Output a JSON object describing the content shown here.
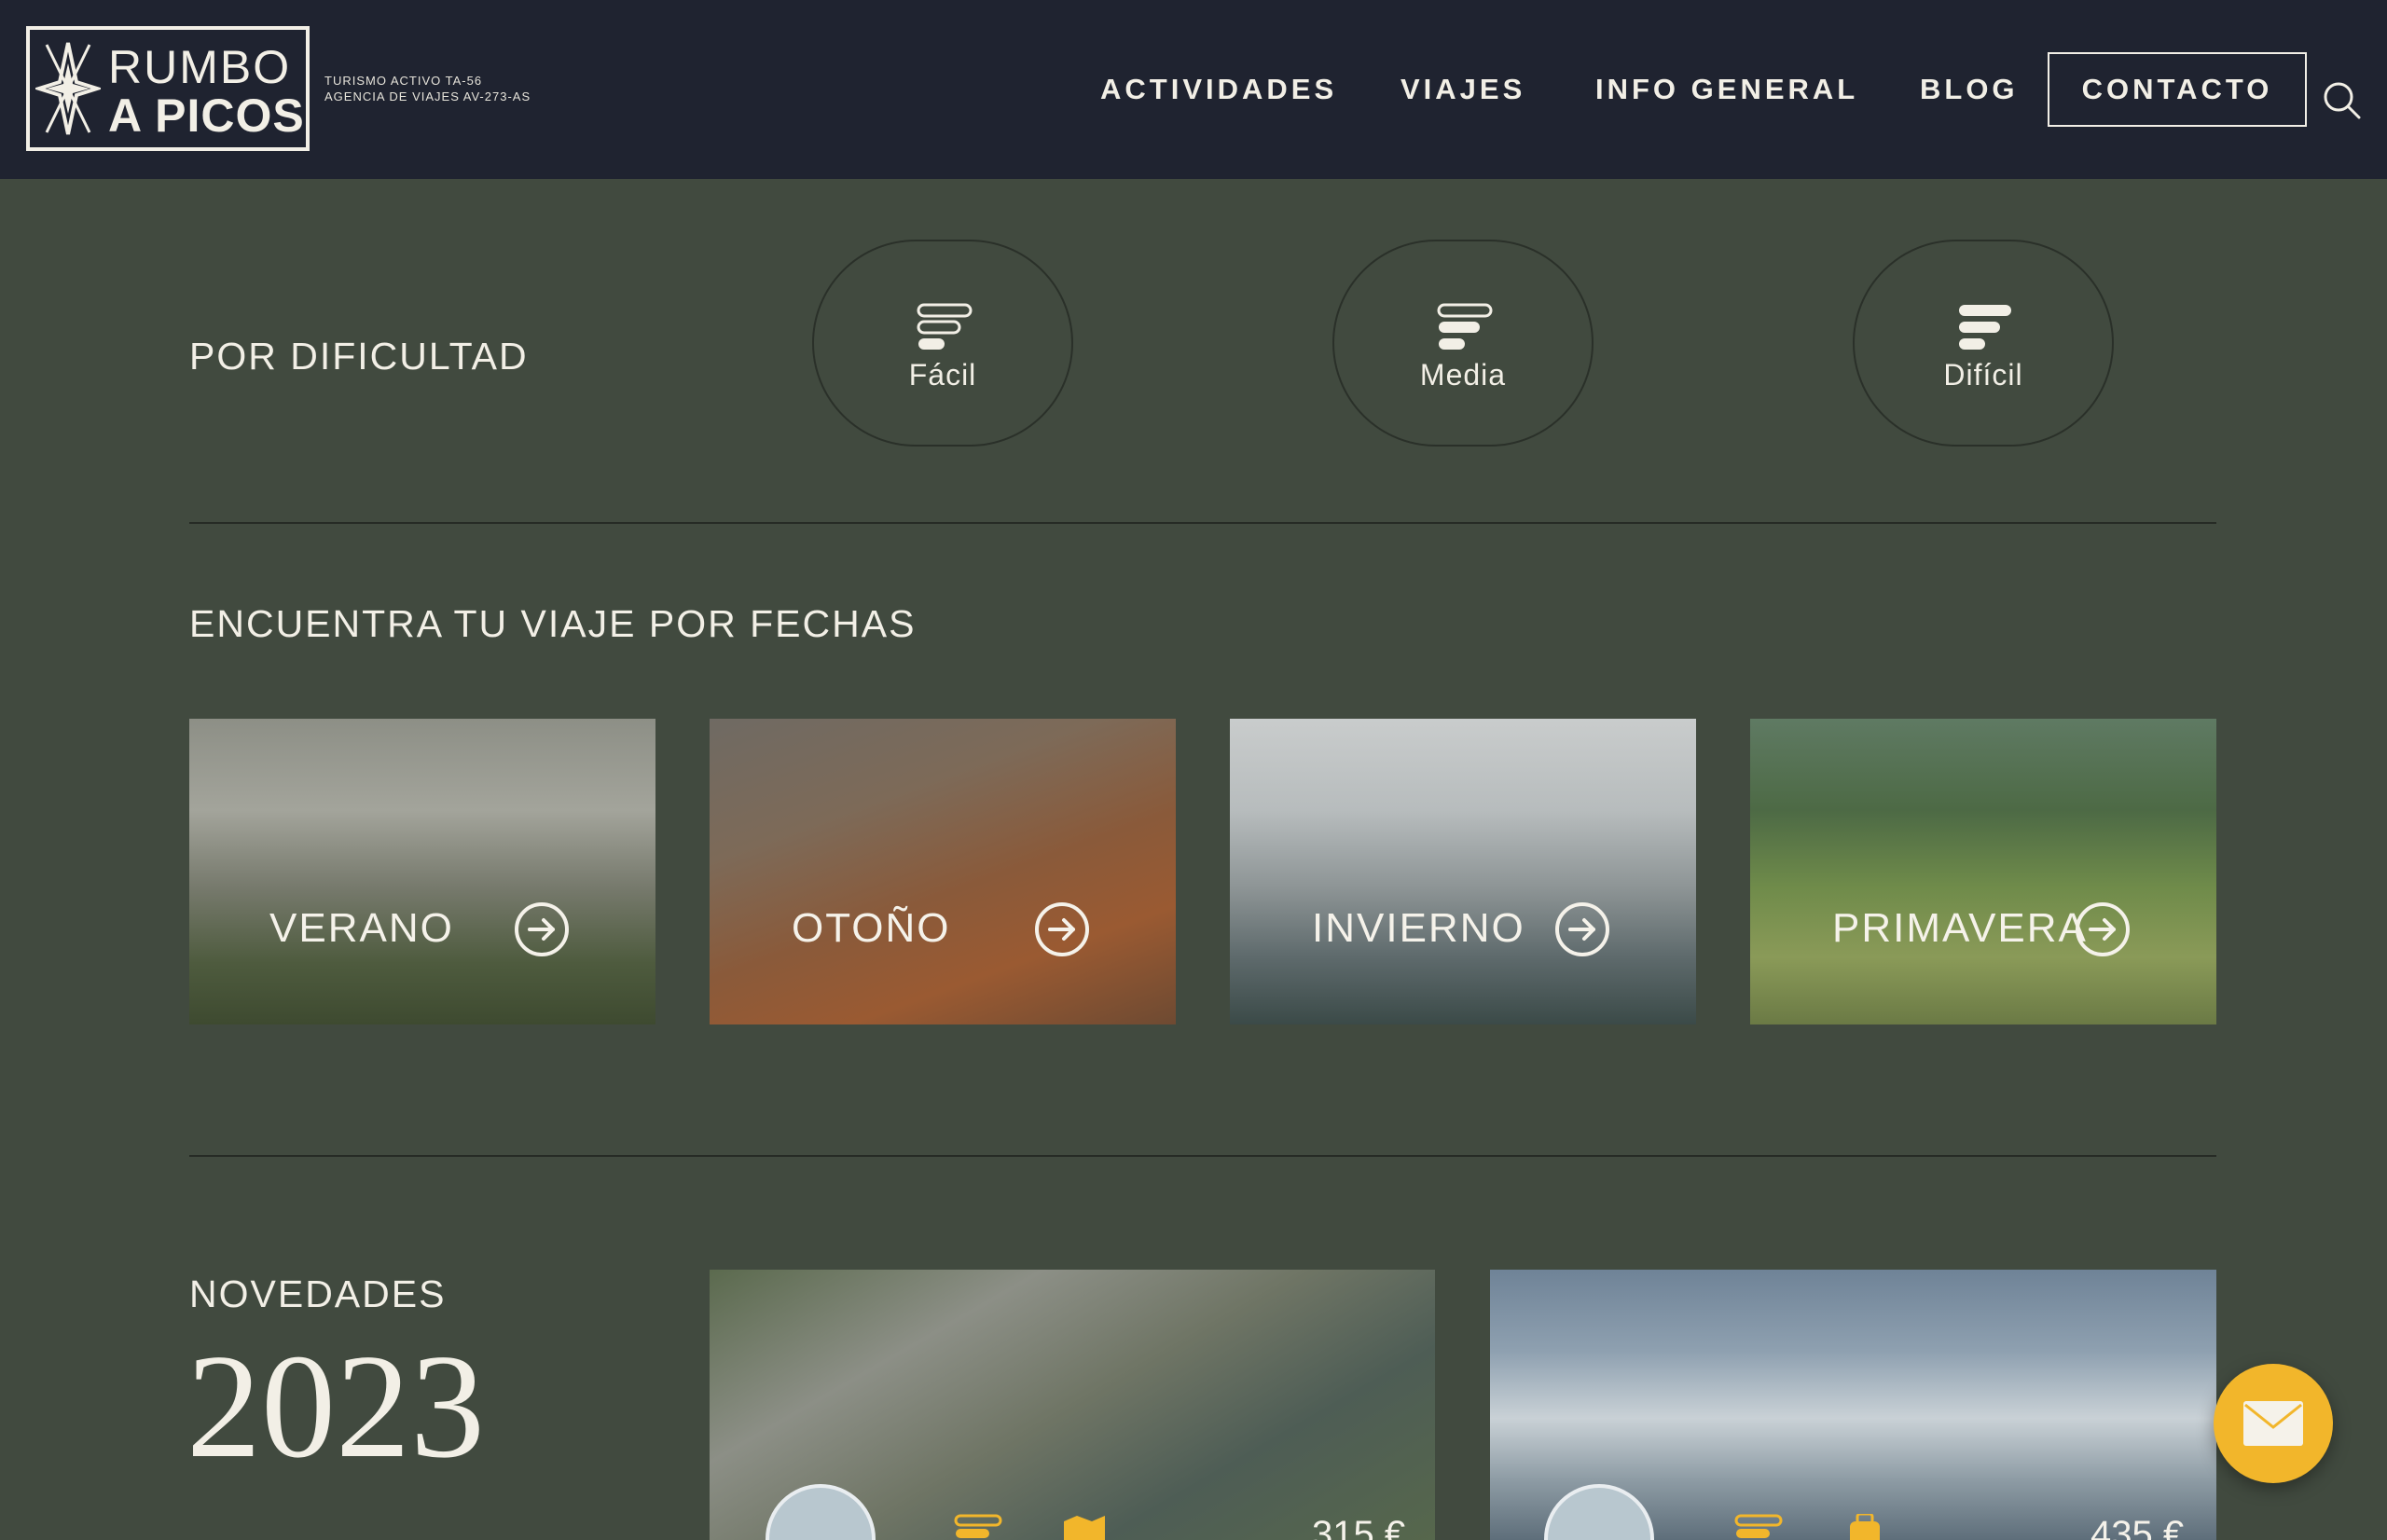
{
  "header": {
    "logo": {
      "line1": "RUMBO",
      "line2": "A PICOS"
    },
    "license_1": "TURISMO ACTIVO TA-56",
    "license_2": "AGENCIA DE VIAJES AV-273-AS",
    "nav": [
      "ACTIVIDADES",
      "VIAJES",
      "INFO GENERAL",
      "BLOG"
    ],
    "contact_label": "CONTACTO"
  },
  "difficulty": {
    "title": "POR DIFICULTAD",
    "levels": [
      {
        "label": "Fácil",
        "level": 1
      },
      {
        "label": "Media",
        "level": 2
      },
      {
        "label": "Difícil",
        "level": 3
      }
    ]
  },
  "dates": {
    "title": "ENCUENTRA TU VIAJE POR FECHAS",
    "seasons": [
      {
        "label": "VERANO"
      },
      {
        "label": "OTOÑO"
      },
      {
        "label": "INVIERNO"
      },
      {
        "label": "PRIMAVERA"
      }
    ]
  },
  "novedades": {
    "title": "NOVEDADES",
    "year": "2023",
    "cards": [
      {
        "price": "315 €"
      },
      {
        "price": "435 €"
      }
    ]
  },
  "colors": {
    "header_bg": "#1f2330",
    "page_bg": "#414a3f",
    "text": "#f2efe6",
    "accent": "#f2b62b"
  },
  "icons": {
    "search": "search-icon",
    "difficulty": "difficulty-bars-icon",
    "arrow": "arrow-right-circle-icon",
    "mail": "mail-icon"
  }
}
